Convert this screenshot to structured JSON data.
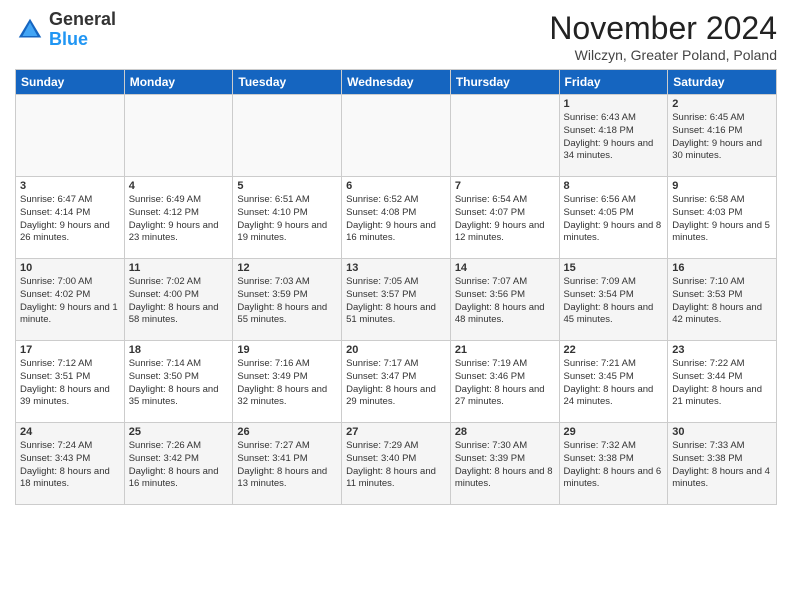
{
  "logo": {
    "text_general": "General",
    "text_blue": "Blue"
  },
  "header": {
    "month_title": "November 2024",
    "subtitle": "Wilczyn, Greater Poland, Poland"
  },
  "days_of_week": [
    "Sunday",
    "Monday",
    "Tuesday",
    "Wednesday",
    "Thursday",
    "Friday",
    "Saturday"
  ],
  "weeks": [
    [
      {
        "day": "",
        "info": ""
      },
      {
        "day": "",
        "info": ""
      },
      {
        "day": "",
        "info": ""
      },
      {
        "day": "",
        "info": ""
      },
      {
        "day": "",
        "info": ""
      },
      {
        "day": "1",
        "info": "Sunrise: 6:43 AM\nSunset: 4:18 PM\nDaylight: 9 hours and 34 minutes."
      },
      {
        "day": "2",
        "info": "Sunrise: 6:45 AM\nSunset: 4:16 PM\nDaylight: 9 hours and 30 minutes."
      }
    ],
    [
      {
        "day": "3",
        "info": "Sunrise: 6:47 AM\nSunset: 4:14 PM\nDaylight: 9 hours and 26 minutes."
      },
      {
        "day": "4",
        "info": "Sunrise: 6:49 AM\nSunset: 4:12 PM\nDaylight: 9 hours and 23 minutes."
      },
      {
        "day": "5",
        "info": "Sunrise: 6:51 AM\nSunset: 4:10 PM\nDaylight: 9 hours and 19 minutes."
      },
      {
        "day": "6",
        "info": "Sunrise: 6:52 AM\nSunset: 4:08 PM\nDaylight: 9 hours and 16 minutes."
      },
      {
        "day": "7",
        "info": "Sunrise: 6:54 AM\nSunset: 4:07 PM\nDaylight: 9 hours and 12 minutes."
      },
      {
        "day": "8",
        "info": "Sunrise: 6:56 AM\nSunset: 4:05 PM\nDaylight: 9 hours and 8 minutes."
      },
      {
        "day": "9",
        "info": "Sunrise: 6:58 AM\nSunset: 4:03 PM\nDaylight: 9 hours and 5 minutes."
      }
    ],
    [
      {
        "day": "10",
        "info": "Sunrise: 7:00 AM\nSunset: 4:02 PM\nDaylight: 9 hours and 1 minute."
      },
      {
        "day": "11",
        "info": "Sunrise: 7:02 AM\nSunset: 4:00 PM\nDaylight: 8 hours and 58 minutes."
      },
      {
        "day": "12",
        "info": "Sunrise: 7:03 AM\nSunset: 3:59 PM\nDaylight: 8 hours and 55 minutes."
      },
      {
        "day": "13",
        "info": "Sunrise: 7:05 AM\nSunset: 3:57 PM\nDaylight: 8 hours and 51 minutes."
      },
      {
        "day": "14",
        "info": "Sunrise: 7:07 AM\nSunset: 3:56 PM\nDaylight: 8 hours and 48 minutes."
      },
      {
        "day": "15",
        "info": "Sunrise: 7:09 AM\nSunset: 3:54 PM\nDaylight: 8 hours and 45 minutes."
      },
      {
        "day": "16",
        "info": "Sunrise: 7:10 AM\nSunset: 3:53 PM\nDaylight: 8 hours and 42 minutes."
      }
    ],
    [
      {
        "day": "17",
        "info": "Sunrise: 7:12 AM\nSunset: 3:51 PM\nDaylight: 8 hours and 39 minutes."
      },
      {
        "day": "18",
        "info": "Sunrise: 7:14 AM\nSunset: 3:50 PM\nDaylight: 8 hours and 35 minutes."
      },
      {
        "day": "19",
        "info": "Sunrise: 7:16 AM\nSunset: 3:49 PM\nDaylight: 8 hours and 32 minutes."
      },
      {
        "day": "20",
        "info": "Sunrise: 7:17 AM\nSunset: 3:47 PM\nDaylight: 8 hours and 29 minutes."
      },
      {
        "day": "21",
        "info": "Sunrise: 7:19 AM\nSunset: 3:46 PM\nDaylight: 8 hours and 27 minutes."
      },
      {
        "day": "22",
        "info": "Sunrise: 7:21 AM\nSunset: 3:45 PM\nDaylight: 8 hours and 24 minutes."
      },
      {
        "day": "23",
        "info": "Sunrise: 7:22 AM\nSunset: 3:44 PM\nDaylight: 8 hours and 21 minutes."
      }
    ],
    [
      {
        "day": "24",
        "info": "Sunrise: 7:24 AM\nSunset: 3:43 PM\nDaylight: 8 hours and 18 minutes."
      },
      {
        "day": "25",
        "info": "Sunrise: 7:26 AM\nSunset: 3:42 PM\nDaylight: 8 hours and 16 minutes."
      },
      {
        "day": "26",
        "info": "Sunrise: 7:27 AM\nSunset: 3:41 PM\nDaylight: 8 hours and 13 minutes."
      },
      {
        "day": "27",
        "info": "Sunrise: 7:29 AM\nSunset: 3:40 PM\nDaylight: 8 hours and 11 minutes."
      },
      {
        "day": "28",
        "info": "Sunrise: 7:30 AM\nSunset: 3:39 PM\nDaylight: 8 hours and 8 minutes."
      },
      {
        "day": "29",
        "info": "Sunrise: 7:32 AM\nSunset: 3:38 PM\nDaylight: 8 hours and 6 minutes."
      },
      {
        "day": "30",
        "info": "Sunrise: 7:33 AM\nSunset: 3:38 PM\nDaylight: 8 hours and 4 minutes."
      }
    ]
  ]
}
